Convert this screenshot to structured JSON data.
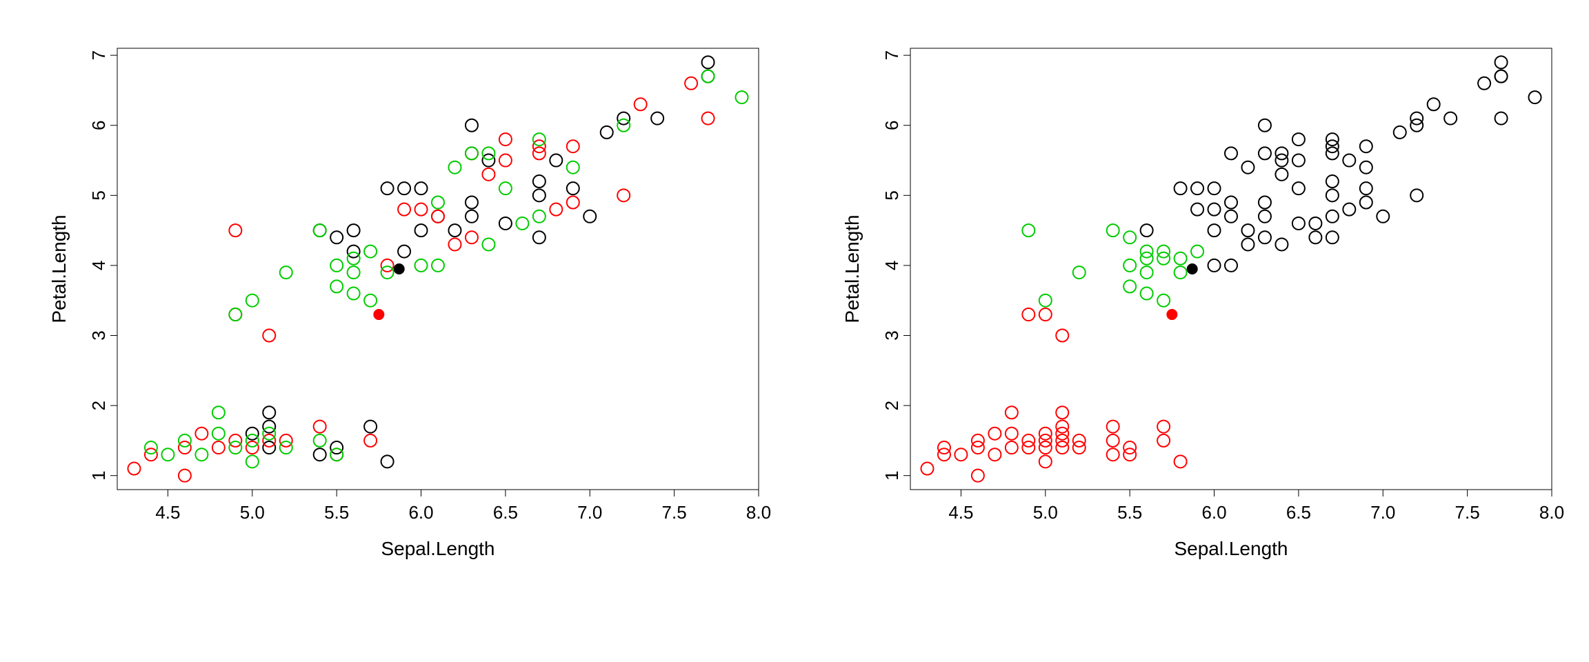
{
  "chart_data": [
    {
      "type": "scatter",
      "name": "left-plot",
      "xlabel": "Sepal.Length",
      "ylabel": "Petal.Length",
      "xlim": [
        4.2,
        8.0
      ],
      "ylim": [
        0.8,
        7.1
      ],
      "xticks": [
        4.5,
        5.0,
        5.5,
        6.0,
        6.5,
        7.0,
        7.5,
        8.0
      ],
      "yticks": [
        1,
        2,
        3,
        4,
        5,
        6,
        7
      ],
      "series": [
        {
          "name": "black-open",
          "color": "#000000",
          "filled": false,
          "points": [
            [
              5.0,
              1.6
            ],
            [
              5.1,
              1.9
            ],
            [
              5.1,
              1.7
            ],
            [
              5.4,
              1.3
            ],
            [
              5.1,
              1.4
            ],
            [
              5.7,
              1.7
            ],
            [
              5.8,
              1.2
            ],
            [
              5.5,
              1.4
            ],
            [
              5.4,
              4.5
            ],
            [
              5.5,
              4.4
            ],
            [
              5.6,
              4.5
            ],
            [
              5.9,
              4.2
            ],
            [
              5.6,
              4.2
            ],
            [
              5.8,
              5.1
            ],
            [
              5.9,
              5.1
            ],
            [
              6.0,
              4.5
            ],
            [
              6.0,
              5.1
            ],
            [
              6.1,
              4.7
            ],
            [
              6.2,
              4.5
            ],
            [
              6.3,
              4.7
            ],
            [
              6.3,
              4.9
            ],
            [
              6.3,
              6.0
            ],
            [
              6.4,
              5.5
            ],
            [
              6.5,
              4.6
            ],
            [
              6.7,
              5.2
            ],
            [
              6.7,
              4.4
            ],
            [
              6.7,
              5.0
            ],
            [
              6.8,
              5.5
            ],
            [
              6.9,
              5.1
            ],
            [
              7.0,
              4.7
            ],
            [
              7.1,
              5.9
            ],
            [
              7.2,
              6.1
            ],
            [
              7.4,
              6.1
            ],
            [
              7.7,
              6.7
            ],
            [
              7.7,
              6.9
            ]
          ]
        },
        {
          "name": "red-open",
          "color": "#ff0000",
          "filled": false,
          "points": [
            [
              4.3,
              1.1
            ],
            [
              4.6,
              1.4
            ],
            [
              4.4,
              1.3
            ],
            [
              4.6,
              1.0
            ],
            [
              4.7,
              1.6
            ],
            [
              4.8,
              1.4
            ],
            [
              5.0,
              1.4
            ],
            [
              4.9,
              1.5
            ],
            [
              5.1,
              1.5
            ],
            [
              5.2,
              1.5
            ],
            [
              5.4,
              1.7
            ],
            [
              5.5,
              1.3
            ],
            [
              5.7,
              1.5
            ],
            [
              4.9,
              3.3
            ],
            [
              4.9,
              4.5
            ],
            [
              5.1,
              3.0
            ],
            [
              5.8,
              4.0
            ],
            [
              5.9,
              4.8
            ],
            [
              6.0,
              4.8
            ],
            [
              6.1,
              4.7
            ],
            [
              6.2,
              4.3
            ],
            [
              6.3,
              4.4
            ],
            [
              6.3,
              5.6
            ],
            [
              6.4,
              5.3
            ],
            [
              6.5,
              5.5
            ],
            [
              6.5,
              5.8
            ],
            [
              6.7,
              5.6
            ],
            [
              6.7,
              5.7
            ],
            [
              6.8,
              4.8
            ],
            [
              6.9,
              5.7
            ],
            [
              6.9,
              4.9
            ],
            [
              7.2,
              5.0
            ],
            [
              7.3,
              6.3
            ],
            [
              7.6,
              6.6
            ],
            [
              7.7,
              6.1
            ]
          ]
        },
        {
          "name": "green-open",
          "color": "#00cc00",
          "filled": false,
          "points": [
            [
              4.4,
              1.4
            ],
            [
              4.5,
              1.3
            ],
            [
              4.6,
              1.5
            ],
            [
              4.7,
              1.3
            ],
            [
              4.8,
              1.9
            ],
            [
              4.8,
              1.6
            ],
            [
              4.9,
              1.4
            ],
            [
              5.0,
              1.5
            ],
            [
              5.0,
              1.2
            ],
            [
              5.1,
              1.6
            ],
            [
              5.2,
              1.4
            ],
            [
              5.4,
              1.5
            ],
            [
              5.5,
              1.3
            ],
            [
              4.9,
              3.3
            ],
            [
              5.0,
              3.5
            ],
            [
              5.2,
              3.9
            ],
            [
              5.6,
              3.6
            ],
            [
              5.5,
              4.0
            ],
            [
              5.6,
              3.9
            ],
            [
              5.7,
              4.2
            ],
            [
              5.8,
              3.9
            ],
            [
              5.6,
              4.1
            ],
            [
              5.5,
              3.7
            ],
            [
              5.4,
              4.5
            ],
            [
              5.7,
              3.5
            ],
            [
              6.0,
              4.0
            ],
            [
              6.1,
              4.0
            ],
            [
              6.1,
              4.9
            ],
            [
              6.2,
              5.4
            ],
            [
              6.3,
              5.6
            ],
            [
              6.4,
              4.3
            ],
            [
              6.4,
              5.6
            ],
            [
              6.5,
              5.1
            ],
            [
              6.6,
              4.6
            ],
            [
              6.7,
              5.8
            ],
            [
              6.7,
              4.7
            ],
            [
              6.9,
              5.4
            ],
            [
              7.2,
              6.0
            ],
            [
              7.7,
              6.7
            ],
            [
              7.9,
              6.4
            ]
          ]
        },
        {
          "name": "black-filled",
          "color": "#000000",
          "filled": true,
          "points": [
            [
              5.87,
              3.95
            ]
          ]
        },
        {
          "name": "red-filled",
          "color": "#ff0000",
          "filled": true,
          "points": [
            [
              5.75,
              3.3
            ]
          ]
        }
      ]
    },
    {
      "type": "scatter",
      "name": "right-plot",
      "xlabel": "Sepal.Length",
      "ylabel": "Petal.Length",
      "xlim": [
        4.2,
        8.0
      ],
      "ylim": [
        0.8,
        7.1
      ],
      "xticks": [
        4.5,
        5.0,
        5.5,
        6.0,
        6.5,
        7.0,
        7.5,
        8.0
      ],
      "yticks": [
        1,
        2,
        3,
        4,
        5,
        6,
        7
      ],
      "series": [
        {
          "name": "red-open",
          "color": "#ff0000",
          "filled": false,
          "points": [
            [
              4.3,
              1.1
            ],
            [
              4.4,
              1.4
            ],
            [
              4.4,
              1.3
            ],
            [
              4.5,
              1.3
            ],
            [
              4.6,
              1.5
            ],
            [
              4.6,
              1.4
            ],
            [
              4.6,
              1.0
            ],
            [
              4.7,
              1.3
            ],
            [
              4.7,
              1.6
            ],
            [
              4.8,
              1.6
            ],
            [
              4.8,
              1.9
            ],
            [
              4.8,
              1.4
            ],
            [
              4.9,
              1.5
            ],
            [
              4.9,
              1.4
            ],
            [
              5.0,
              1.2
            ],
            [
              5.0,
              1.6
            ],
            [
              5.0,
              1.4
            ],
            [
              5.0,
              1.5
            ],
            [
              5.1,
              1.4
            ],
            [
              5.1,
              1.7
            ],
            [
              5.1,
              1.9
            ],
            [
              5.1,
              1.5
            ],
            [
              5.1,
              1.6
            ],
            [
              5.2,
              1.5
            ],
            [
              5.2,
              1.4
            ],
            [
              5.4,
              1.7
            ],
            [
              5.4,
              1.5
            ],
            [
              5.4,
              1.3
            ],
            [
              5.5,
              1.4
            ],
            [
              5.5,
              1.3
            ],
            [
              5.7,
              1.5
            ],
            [
              5.7,
              1.7
            ],
            [
              5.8,
              1.2
            ],
            [
              4.9,
              3.3
            ],
            [
              5.0,
              3.3
            ],
            [
              5.1,
              3.0
            ]
          ]
        },
        {
          "name": "green-open",
          "color": "#00cc00",
          "filled": false,
          "points": [
            [
              4.9,
              4.5
            ],
            [
              5.0,
              3.5
            ],
            [
              5.2,
              3.9
            ],
            [
              5.4,
              4.5
            ],
            [
              5.5,
              4.0
            ],
            [
              5.5,
              3.7
            ],
            [
              5.5,
              4.4
            ],
            [
              5.6,
              3.6
            ],
            [
              5.6,
              3.9
            ],
            [
              5.6,
              4.1
            ],
            [
              5.6,
              4.2
            ],
            [
              5.7,
              3.5
            ],
            [
              5.7,
              4.2
            ],
            [
              5.7,
              4.1
            ],
            [
              5.8,
              3.9
            ],
            [
              5.8,
              4.1
            ],
            [
              5.9,
              4.2
            ]
          ]
        },
        {
          "name": "black-open",
          "color": "#000000",
          "filled": false,
          "points": [
            [
              5.6,
              4.5
            ],
            [
              5.8,
              5.1
            ],
            [
              5.9,
              4.8
            ],
            [
              5.9,
              5.1
            ],
            [
              6.0,
              4.5
            ],
            [
              6.0,
              4.8
            ],
            [
              6.0,
              5.1
            ],
            [
              6.0,
              4.0
            ],
            [
              6.1,
              4.7
            ],
            [
              6.1,
              4.0
            ],
            [
              6.1,
              4.9
            ],
            [
              6.1,
              5.6
            ],
            [
              6.2,
              4.5
            ],
            [
              6.2,
              5.4
            ],
            [
              6.2,
              4.3
            ],
            [
              6.3,
              4.7
            ],
            [
              6.3,
              6.0
            ],
            [
              6.3,
              5.6
            ],
            [
              6.3,
              4.4
            ],
            [
              6.3,
              4.9
            ],
            [
              6.4,
              5.5
            ],
            [
              6.4,
              4.3
            ],
            [
              6.4,
              5.6
            ],
            [
              6.4,
              5.3
            ],
            [
              6.5,
              4.6
            ],
            [
              6.5,
              5.1
            ],
            [
              6.5,
              5.5
            ],
            [
              6.5,
              5.8
            ],
            [
              6.6,
              4.4
            ],
            [
              6.6,
              4.6
            ],
            [
              6.7,
              5.7
            ],
            [
              6.7,
              5.2
            ],
            [
              6.7,
              4.4
            ],
            [
              6.7,
              5.0
            ],
            [
              6.7,
              5.8
            ],
            [
              6.7,
              5.6
            ],
            [
              6.7,
              4.7
            ],
            [
              6.8,
              5.5
            ],
            [
              6.8,
              4.8
            ],
            [
              6.9,
              5.1
            ],
            [
              6.9,
              5.4
            ],
            [
              6.9,
              4.9
            ],
            [
              6.9,
              5.7
            ],
            [
              7.0,
              4.7
            ],
            [
              7.1,
              5.9
            ],
            [
              7.2,
              6.1
            ],
            [
              7.2,
              5.0
            ],
            [
              7.2,
              6.0
            ],
            [
              7.3,
              6.3
            ],
            [
              7.4,
              6.1
            ],
            [
              7.6,
              6.6
            ],
            [
              7.7,
              6.7
            ],
            [
              7.7,
              6.9
            ],
            [
              7.7,
              6.7
            ],
            [
              7.7,
              6.1
            ],
            [
              7.9,
              6.4
            ]
          ]
        },
        {
          "name": "black-filled",
          "color": "#000000",
          "filled": true,
          "points": [
            [
              5.87,
              3.95
            ]
          ]
        },
        {
          "name": "red-filled",
          "color": "#ff0000",
          "filled": true,
          "points": [
            [
              5.75,
              3.3
            ]
          ]
        }
      ]
    }
  ]
}
